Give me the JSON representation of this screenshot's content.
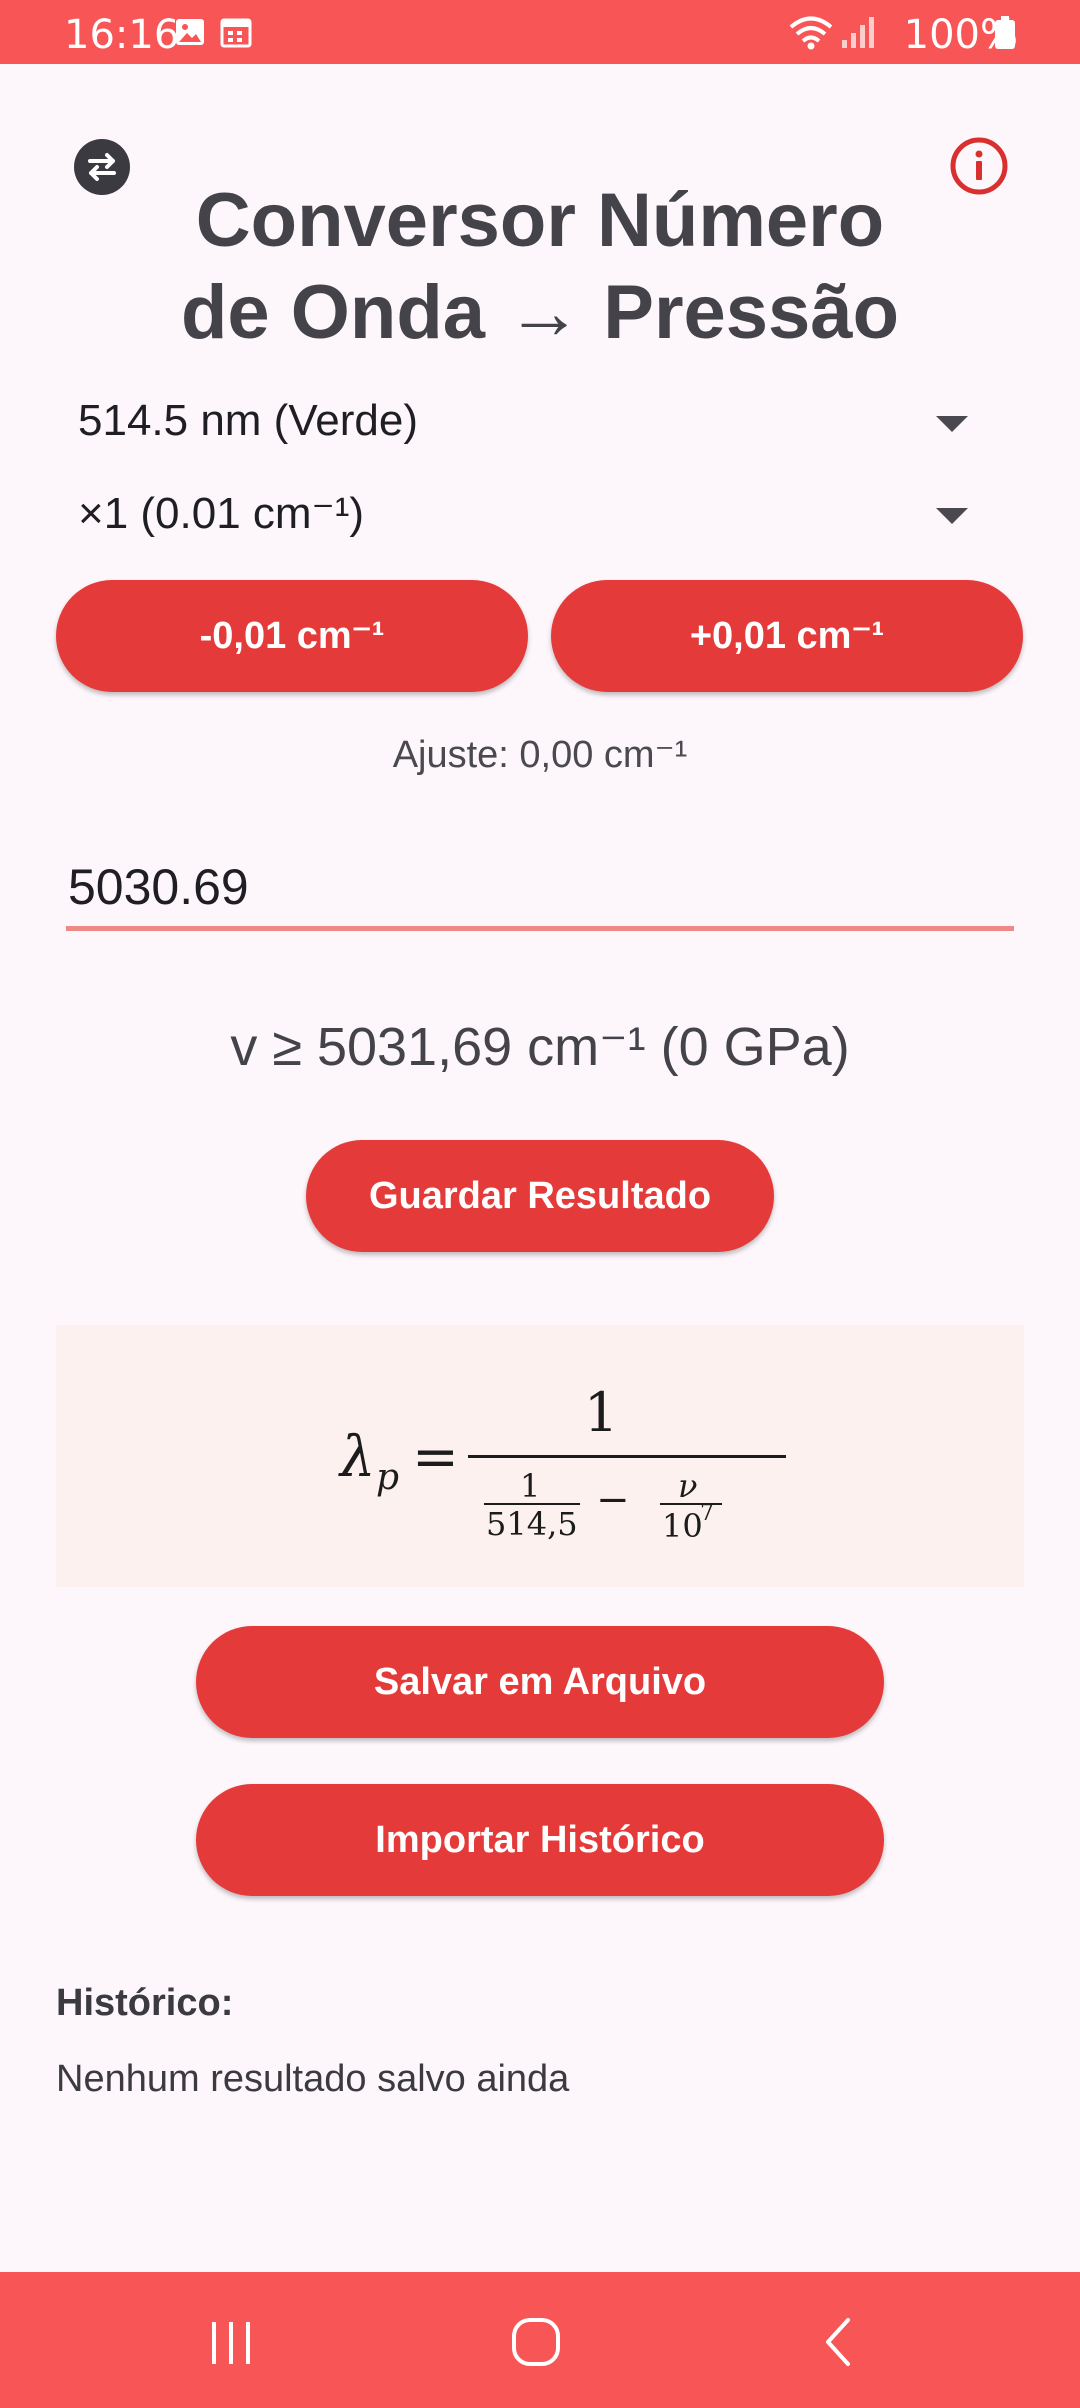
{
  "status": {
    "time": "16:16",
    "battery": "100%"
  },
  "header": {
    "title_line1": "Conversor Número",
    "title_line2": "de Onda → Pressão"
  },
  "selectors": {
    "laser": "514.5 nm (Verde)",
    "step": "×1 (0.01 cm⁻¹)"
  },
  "buttons": {
    "minus": "-0,01 cm⁻¹",
    "plus": "+0,01 cm⁻¹",
    "save_result": "Guardar Resultado",
    "save_file": "Salvar em Arquivo",
    "import_history": "Importar Histórico"
  },
  "adjust_text": "Ajuste: 0,00 cm⁻¹",
  "input": {
    "value": "5030.69"
  },
  "result_text": "v ≥ 5031,69 cm⁻¹ (0 GPa)",
  "formula": {
    "lhs": "λ",
    "lhs_sub": "p",
    "equals": "=",
    "numerator": "1",
    "inner_num": "1",
    "inner_den": "514,5",
    "minus": "−",
    "nu": "ν",
    "ten": "10",
    "exp": "7"
  },
  "history": {
    "title": "Histórico:",
    "empty": "Nenhum resultado salvo ainda"
  },
  "icons": {
    "swap": "swap-icon",
    "info": "info-icon",
    "wifi": "wifi-icon",
    "signal": "signal-icon",
    "battery": "battery-icon",
    "gallery": "gallery-icon",
    "calendar": "calendar-icon"
  },
  "colors": {
    "accent": "#e53a3a",
    "bars": "#f85556",
    "info": "#d8302f"
  }
}
